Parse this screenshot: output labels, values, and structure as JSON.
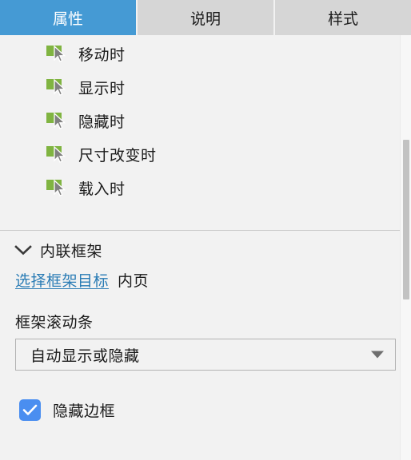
{
  "tabs": [
    {
      "label": "属性",
      "active": true
    },
    {
      "label": "说明",
      "active": false
    },
    {
      "label": "样式",
      "active": false
    }
  ],
  "events": {
    "items": [
      {
        "label": "移动时",
        "icon": "event-cursor-icon"
      },
      {
        "label": "显示时",
        "icon": "event-cursor-icon"
      },
      {
        "label": "隐藏时",
        "icon": "event-cursor-icon"
      },
      {
        "label": "尺寸改变时",
        "icon": "event-cursor-icon"
      },
      {
        "label": "载入时",
        "icon": "event-cursor-icon"
      }
    ]
  },
  "inline_frame": {
    "section_title": "内联框架",
    "collapse_icon": "chevron-down-icon",
    "frame_target_link": "选择框架目标",
    "frame_target_value": "内页",
    "scrollbar_label": "框架滚动条",
    "scrollbar_value": "自动显示或隐藏",
    "scrollbar_dropdown_icon": "caret-down-icon",
    "hide_border_label": "隐藏边框",
    "hide_border_checked": true,
    "checkbox_icon": "checkmark-icon"
  },
  "colors": {
    "tab_active_bg": "#459ad4",
    "tab_inactive_bg": "#d6d6d6",
    "panel_bg": "#f2f2f2",
    "link": "#2a7cb5",
    "checkbox_accent": "#4a8ef0",
    "event_icon_green": "#80b441"
  }
}
